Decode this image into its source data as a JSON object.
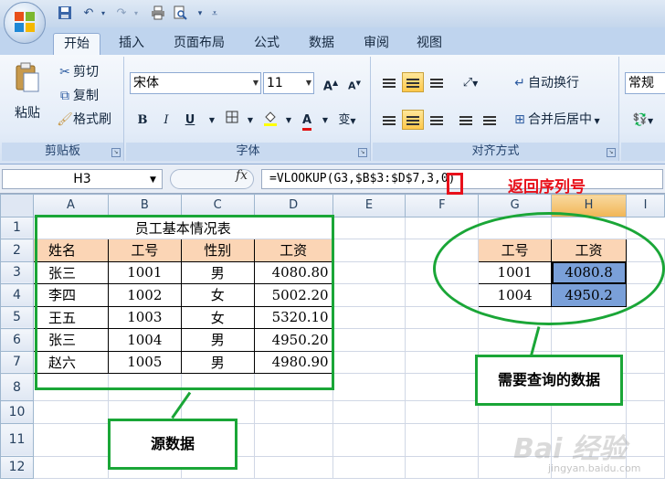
{
  "quick_access": {
    "save": "save-icon",
    "undo": "undo-icon",
    "redo": "redo-icon",
    "print": "printer-icon",
    "preview": "print-preview-icon"
  },
  "tabs": [
    {
      "label": "开始",
      "active": true
    },
    {
      "label": "插入"
    },
    {
      "label": "页面布局"
    },
    {
      "label": "公式"
    },
    {
      "label": "数据"
    },
    {
      "label": "审阅"
    },
    {
      "label": "视图"
    }
  ],
  "clipboard": {
    "paste": "粘贴",
    "cut": "剪切",
    "copy": "复制",
    "format_painter": "格式刷",
    "label": "剪贴板"
  },
  "font": {
    "name": "宋体",
    "size": "11",
    "bold": "B",
    "italic": "I",
    "underline": "U",
    "grow": "A",
    "shrink": "A",
    "font_color_letter": "A",
    "phonetic": "变",
    "label": "字体"
  },
  "alignment": {
    "wrap": "自动换行",
    "merge": "合并后居中",
    "label": "对齐方式"
  },
  "number": {
    "format": "常规"
  },
  "formula_bar": {
    "cell_ref": "H3",
    "fx": "fx",
    "formula": "=VLOOKUP(G3,$B$3:$D$7,3,0)"
  },
  "sheet": {
    "columns": [
      "A",
      "B",
      "C",
      "D",
      "E",
      "F",
      "G",
      "H",
      "I"
    ],
    "rows": [
      "1",
      "2",
      "3",
      "4",
      "5",
      "6",
      "7",
      "8",
      "10",
      "11",
      "12"
    ],
    "title": "员工基本情况表",
    "source_headers": [
      "姓名",
      "工号",
      "性别",
      "工资"
    ],
    "source_rows": [
      [
        "张三",
        "1001",
        "男",
        "4080.80"
      ],
      [
        "李四",
        "1002",
        "女",
        "5002.20"
      ],
      [
        "王五",
        "1003",
        "女",
        "5320.10"
      ],
      [
        "张三",
        "1004",
        "男",
        "4950.20"
      ],
      [
        "赵六",
        "1005",
        "男",
        "4980.90"
      ]
    ],
    "lookup_headers": [
      "工号",
      "工资"
    ],
    "lookup_rows": [
      [
        "1001",
        "4080.8"
      ],
      [
        "1004",
        "4950.2"
      ]
    ]
  },
  "annotations": {
    "return_index": "返回序列号",
    "source_data": "源数据",
    "query_data": "需要查询的数据"
  },
  "watermark": {
    "brand": "Bai 经验",
    "site": "jingyan.baidu.com"
  },
  "colors": {
    "annotation_green": "#1aa637",
    "annotation_red": "#e8101a",
    "header_fill": "#fbd5b5",
    "result_fill": "#7aa0d9"
  }
}
